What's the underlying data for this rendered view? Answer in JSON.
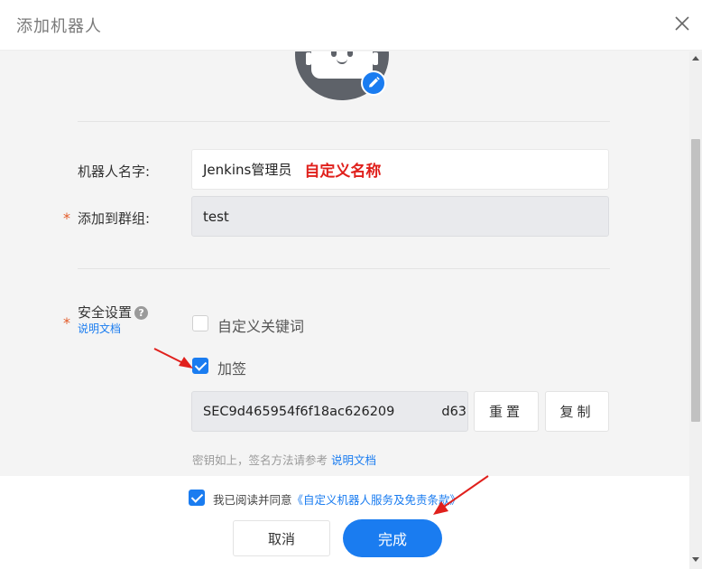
{
  "dialog": {
    "title": "添加机器人"
  },
  "form": {
    "name_label": "机器人名字:",
    "name_value": "Jenkins管理员",
    "name_annotation": "自定义名称",
    "group_label": "添加到群组:",
    "group_value": "test",
    "required_mark": "*",
    "security_label": "安全设置",
    "help_glyph": "?",
    "doc_link": "说明文档",
    "option_keyword": "自定义关键词",
    "option_sign": "加签",
    "secret_value": "SEC9d465954f6f18ac626209",
    "secret_tail": "d63",
    "reset_label": "重置",
    "copy_label": "复制",
    "hint_text": "密钥如上，签名方法请参考",
    "hint_link": "说明文档"
  },
  "footer": {
    "agree_prefix": "我已阅读并同意",
    "agree_link": "《自定义机器人服务及免责条款》",
    "cancel_label": "取消",
    "done_label": "完成"
  },
  "state": {
    "keyword_checked": false,
    "sign_checked": true,
    "agree_checked": true
  },
  "colors": {
    "accent": "#1a7cf0",
    "annotation": "#e0201c",
    "required": "#e35b29"
  }
}
